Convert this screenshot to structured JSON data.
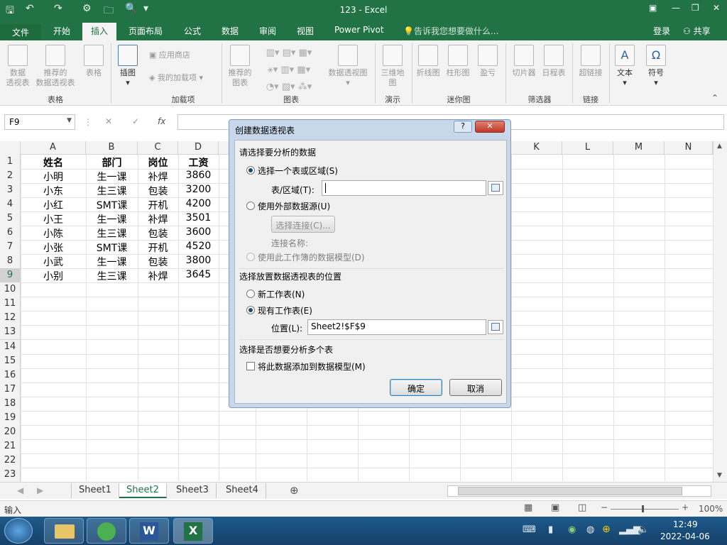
{
  "app": {
    "title": "123 - Excel"
  },
  "tabs": [
    "文件",
    "开始",
    "插入",
    "页面布局",
    "公式",
    "数据",
    "审阅",
    "视图",
    "Power Pivot"
  ],
  "active_tab": "插入",
  "tellme": "告诉我您想要做什么...",
  "signin": "登录",
  "share": "共享",
  "ribbon": {
    "pivot_table": "数据\n透视表",
    "recommended_pivot": "推荐的\n数据透视表",
    "table": "表格",
    "illustrations": "插图",
    "store": "应用商店",
    "my_addins": "我的加载项",
    "recommended_charts": "推荐的\n图表",
    "pivot_chart": "数据透视图",
    "map3d": "三维地\n图",
    "line": "折线图",
    "column": "柱形图",
    "winloss": "盈亏",
    "slicer": "切片器",
    "timeline": "日程表",
    "hyperlink": "超链接",
    "text": "文本",
    "symbol": "符号",
    "groups": {
      "tables": "表格",
      "addins": "加载项",
      "charts": "图表",
      "tours": "演示",
      "sparklines": "迷你图",
      "filters": "筛选器",
      "links": "链接"
    }
  },
  "namebox": "F9",
  "fx": "fx",
  "columns": [
    "A",
    "B",
    "C",
    "D",
    "E",
    "F",
    "G",
    "H",
    "I",
    "J",
    "K",
    "L",
    "M",
    "N"
  ],
  "rows": [
    "1",
    "2",
    "3",
    "4",
    "5",
    "6",
    "7",
    "8",
    "9",
    "10",
    "11",
    "12",
    "13",
    "14",
    "15",
    "16",
    "17",
    "18",
    "19",
    "20",
    "21",
    "22",
    "23"
  ],
  "table": [
    [
      "姓名",
      "部门",
      "岗位",
      "工资"
    ],
    [
      "小明",
      "生一课",
      "补焊",
      "3860"
    ],
    [
      "小东",
      "生三课",
      "包装",
      "3200"
    ],
    [
      "小红",
      "SMT课",
      "开机",
      "4200"
    ],
    [
      "小王",
      "生一课",
      "补焊",
      "3501"
    ],
    [
      "小陈",
      "生三课",
      "包装",
      "3600"
    ],
    [
      "小张",
      "SMT课",
      "开机",
      "4520"
    ],
    [
      "小武",
      "生一课",
      "包装",
      "3800"
    ],
    [
      "小别",
      "生三课",
      "补焊",
      "3645"
    ]
  ],
  "sheets": [
    "Sheet1",
    "Sheet2",
    "Sheet3",
    "Sheet4"
  ],
  "active_sheet": "Sheet2",
  "status": {
    "mode": "输入",
    "zoom": "100%"
  },
  "dialog": {
    "title": "创建数据透视表",
    "help": "?",
    "close": "✕",
    "section1": "请选择要分析的数据",
    "opt_range": "选择一个表或区域(S)",
    "range_label": "表/区域(T):",
    "range_value": "",
    "opt_external": "使用外部数据源(U)",
    "choose_conn": "选择连接(C)...",
    "conn_name": "连接名称:",
    "opt_model": "使用此工作簿的数据模型(D)",
    "section2": "选择放置数据透视表的位置",
    "opt_new": "新工作表(N)",
    "opt_existing": "现有工作表(E)",
    "loc_label": "位置(L):",
    "loc_value": "Sheet2!$F$9",
    "section3": "选择是否想要分析多个表",
    "add_model": "将此数据添加到数据模型(M)",
    "ok": "确定",
    "cancel": "取消"
  },
  "clock": {
    "time": "12:49",
    "date": "2022-04-06"
  }
}
